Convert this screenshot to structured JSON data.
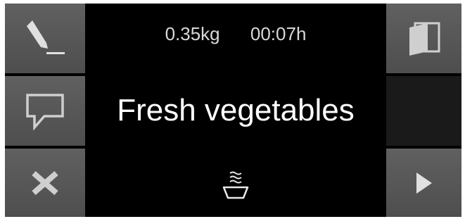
{
  "left_buttons": [
    {
      "name": "edit",
      "icon": "pencil-icon"
    },
    {
      "name": "message",
      "icon": "speech-bubble-icon"
    },
    {
      "name": "cancel",
      "icon": "x-icon"
    }
  ],
  "right_buttons": [
    {
      "name": "door",
      "icon": "door-open-icon"
    },
    {
      "name": "empty"
    },
    {
      "name": "start",
      "icon": "play-icon"
    }
  ],
  "status": {
    "weight": "0.35kg",
    "time": "00:07h"
  },
  "program": {
    "title": "Fresh vegetables",
    "icon": "steam-bowl-icon"
  },
  "colors": {
    "screen_bg": "#000000",
    "button_bg": "#5a5a5a",
    "icon_color": "#d0d0d0"
  }
}
